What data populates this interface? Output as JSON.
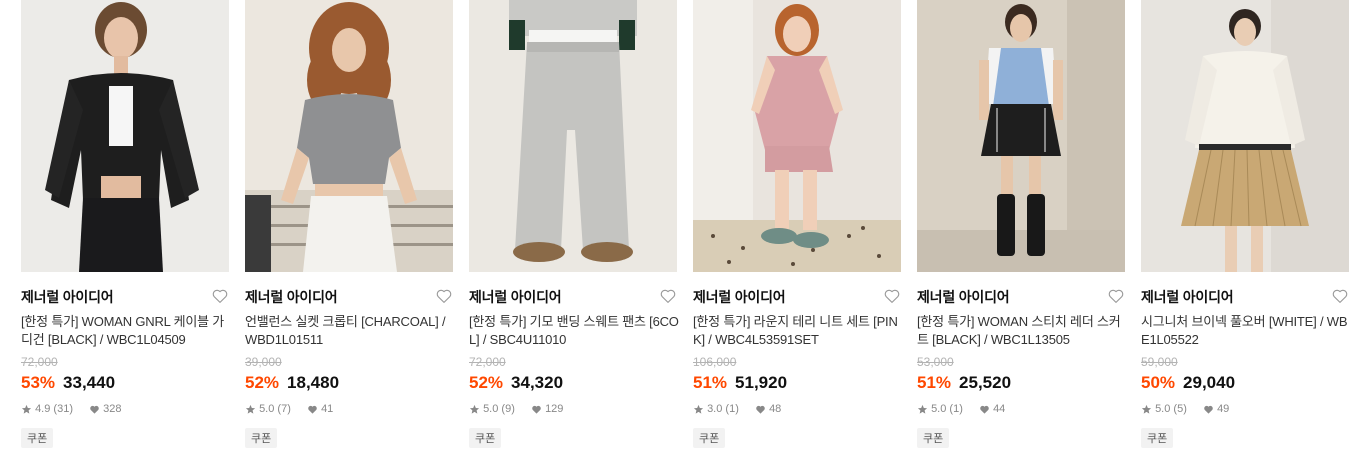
{
  "products": [
    {
      "brand": "제너럴 아이디어",
      "name": "[한정 특가] WOMAN GNRL 케이블 가디건 [BLACK] / WBC1L04509",
      "original_price": "72,000",
      "discount": "53%",
      "price": "33,440",
      "rating": "4.9",
      "review_count": "(31)",
      "likes": "328",
      "coupon": "쿠폰",
      "image_icon": "model-black-cardigan-photo"
    },
    {
      "brand": "제너럴 아이디어",
      "name": "언밸런스 실켓 크롭티 [CHARCOAL] / WBD1L01511",
      "original_price": "39,000",
      "discount": "52%",
      "price": "18,480",
      "rating": "5.0",
      "review_count": "(7)",
      "likes": "41",
      "coupon": "쿠폰",
      "image_icon": "model-charcoal-crop-tee-photo"
    },
    {
      "brand": "제너럴 아이디어",
      "name": "[한정 특가] 기모 밴딩 스웨트 팬츠 [6COL] / SBC4U11010",
      "original_price": "72,000",
      "discount": "52%",
      "price": "34,320",
      "rating": "5.0",
      "review_count": "(9)",
      "likes": "129",
      "coupon": "쿠폰",
      "image_icon": "model-sweat-pants-photo"
    },
    {
      "brand": "제너럴 아이디어",
      "name": "[한정 특가] 라운지 테리 니트 세트 [PINK] / WBC4L53591SET",
      "original_price": "106,000",
      "discount": "51%",
      "price": "51,920",
      "rating": "3.0",
      "review_count": "(1)",
      "likes": "48",
      "coupon": "쿠폰",
      "image_icon": "model-pink-knit-set-photo"
    },
    {
      "brand": "제너럴 아이디어",
      "name": "[한정 특가] WOMAN 스티치 레더 스커트 [BLACK] / WBC1L13505",
      "original_price": "53,000",
      "discount": "51%",
      "price": "25,520",
      "rating": "5.0",
      "review_count": "(1)",
      "likes": "44",
      "coupon": "쿠폰",
      "image_icon": "model-leather-skirt-photo"
    },
    {
      "brand": "제너럴 아이디어",
      "name": "시그니처 브이넥 풀오버 [WHITE] / WBE1L05522",
      "original_price": "59,000",
      "discount": "50%",
      "price": "29,040",
      "rating": "5.0",
      "review_count": "(5)",
      "likes": "49",
      "coupon": "쿠폰",
      "image_icon": "model-white-pullover-photo"
    }
  ],
  "colors": {
    "discount": "#ff4800",
    "muted": "#888888",
    "strike": "#b3b3b3"
  }
}
